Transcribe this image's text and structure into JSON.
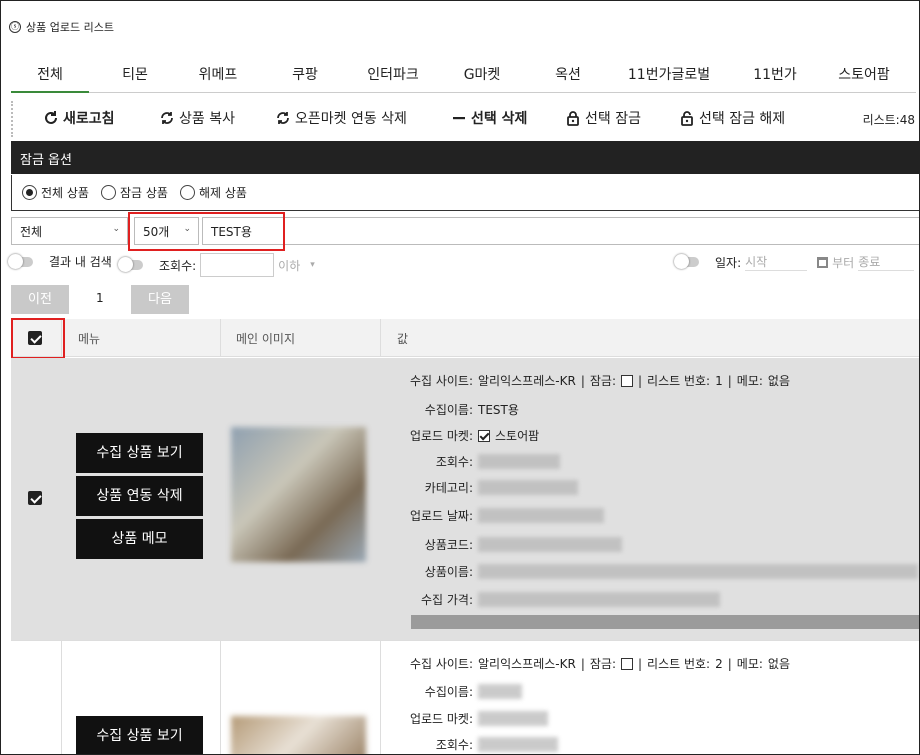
{
  "app": {
    "title": "상품 업로드 리스트"
  },
  "tabs": [
    {
      "label": "전체",
      "active": true
    },
    {
      "label": "티몬"
    },
    {
      "label": "위메프"
    },
    {
      "label": "쿠팡"
    },
    {
      "label": "인터파크"
    },
    {
      "label": "G마켓"
    },
    {
      "label": "옥션"
    },
    {
      "label": "11번가글로벌"
    },
    {
      "label": "11번가"
    },
    {
      "label": "스토어팜"
    }
  ],
  "toolbar": {
    "refresh": "새로고침",
    "copy": "상품 복사",
    "unlink": "오픈마켓 연동 삭제",
    "delete_sel": "선택 삭제",
    "lock_sel": "선택 잠금",
    "unlock_sel": "선택 잠금 해제",
    "list_count": "리스트:48"
  },
  "lock_section": {
    "header": "잠금 옵션",
    "options": [
      "전체 상품",
      "잠금 상품",
      "해제 상품"
    ],
    "selected": "전체 상품"
  },
  "filters": {
    "category_select": "전체",
    "per_page_select": "50개",
    "search_value": "TEST용",
    "search_in_results": "결과 내 검색",
    "views_label": "조회수:",
    "views_below": "이하",
    "date_label": "일자:",
    "date_start_placeholder": "시작",
    "date_between": "부터",
    "date_end_placeholder": "종료"
  },
  "pagination": {
    "prev": "이전",
    "page": "1",
    "next": "다음"
  },
  "table": {
    "headers": [
      "메뉴",
      "메인 이미지",
      "값"
    ]
  },
  "rows": [
    {
      "checked": true,
      "buttons": [
        "수집 상품 보기",
        "상품 연동 삭제",
        "상품 메모"
      ],
      "site_label": "수집 사이트:",
      "site_value": "알리익스프레스-KR",
      "lock_label": "잠금:",
      "list_no_label": "리스트 번호:",
      "list_no": "1",
      "memo_label": "메모:",
      "memo": "없음",
      "name_label": "수집이름:",
      "name_value": "TEST용",
      "market_label": "업로드 마켓:",
      "market_value": "스토어팜",
      "views_label": "조회수:",
      "category_label": "카테고리:",
      "date_label": "업로드 날짜:",
      "code_label": "상품코드:",
      "pname_label": "상품이름:",
      "price_label": "수집 가격:"
    },
    {
      "checked": false,
      "buttons": [
        "수집 상품 보기"
      ],
      "site_label": "수집 사이트:",
      "site_value": "알리익스프레스-KR",
      "lock_label": "잠금:",
      "list_no_label": "리스트 번호:",
      "list_no": "2",
      "memo_label": "메모:",
      "memo": "없음",
      "name_label": "수집이름:",
      "market_label": "업로드 마켓:",
      "views_label": "조회수:"
    }
  ],
  "colors": {
    "accent": "#3a8a3a",
    "highlight": "#e02020",
    "dark": "#222222"
  }
}
